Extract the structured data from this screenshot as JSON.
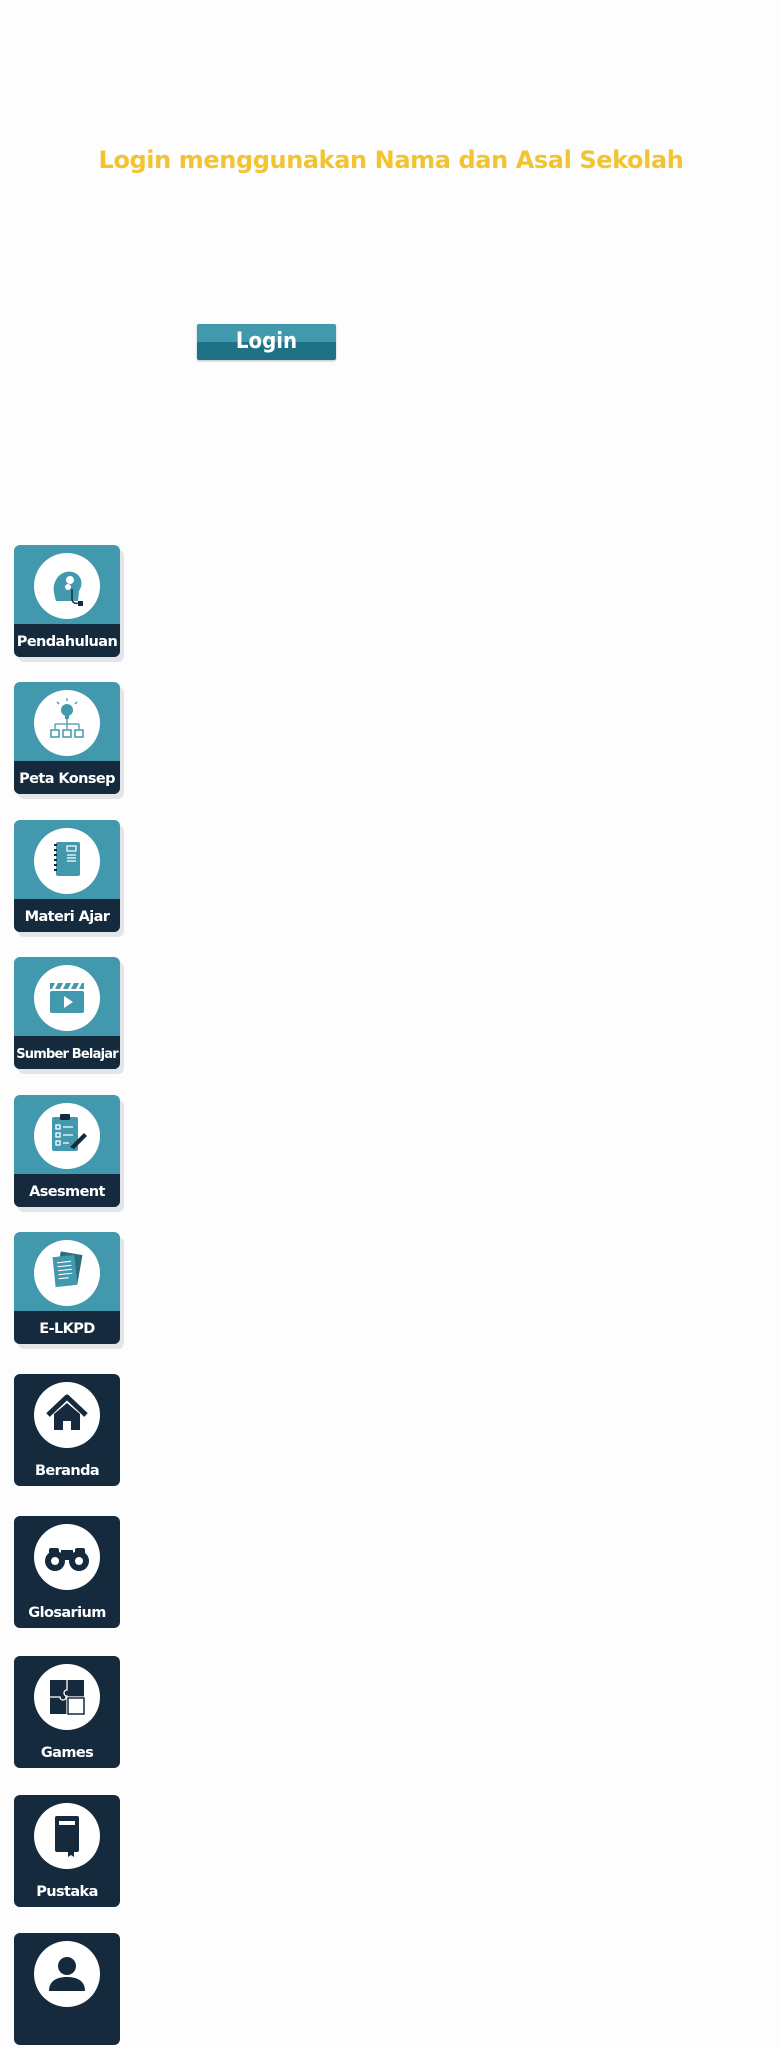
{
  "header": {
    "title": "Login menggunakan Nama dan Asal Sekolah"
  },
  "login": {
    "label": "Login"
  },
  "colors": {
    "title": "#f3c432",
    "teal": "#4298ac",
    "teal_dark": "#1f7186",
    "navy": "#162a3e"
  },
  "menu": {
    "items": [
      {
        "label": "Pendahuluan",
        "icon": "head-gears-icon"
      },
      {
        "label": "Peta Konsep",
        "icon": "lightbulb-hierarchy-icon"
      },
      {
        "label": "Materi Ajar",
        "icon": "notebook-icon"
      },
      {
        "label": "Sumber Belajar",
        "icon": "clapperboard-play-icon"
      },
      {
        "label": "Asesment",
        "icon": "clipboard-checklist-icon"
      },
      {
        "label": "E-LKPD",
        "icon": "documents-icon"
      }
    ]
  },
  "nav": {
    "items": [
      {
        "label": "Beranda",
        "icon": "home-icon"
      },
      {
        "label": "Glosarium",
        "icon": "binoculars-icon"
      },
      {
        "label": "Games",
        "icon": "puzzle-icon"
      },
      {
        "label": "Pustaka",
        "icon": "book-icon"
      },
      {
        "label": "",
        "icon": "user-profile-icon"
      }
    ]
  }
}
